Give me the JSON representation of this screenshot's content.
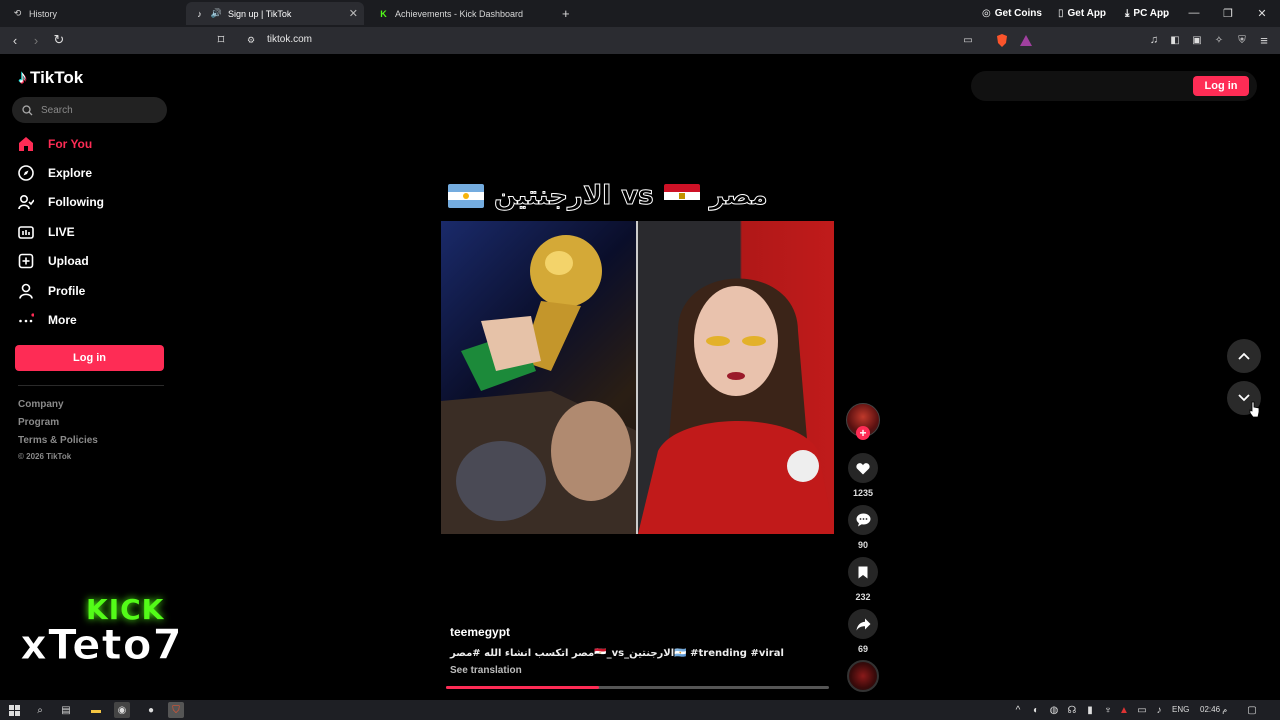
{
  "browser": {
    "tabs": [
      {
        "label": "History",
        "icon": "history-icon"
      },
      {
        "label": "Sign up | TikTok",
        "icon": "tiktok-icon"
      },
      {
        "label": "Achievements - Kick Dashboard",
        "icon": "kick-icon"
      }
    ],
    "url": "tiktok.com"
  },
  "sidebar": {
    "logo_text": "TikTok",
    "search_placeholder": "Search",
    "items": [
      {
        "label": "For You",
        "icon": "home-icon",
        "active": true
      },
      {
        "label": "Explore",
        "icon": "compass-icon"
      },
      {
        "label": "Following",
        "icon": "following-icon"
      },
      {
        "label": "LIVE",
        "icon": "live-icon"
      },
      {
        "label": "Upload",
        "icon": "upload-icon"
      },
      {
        "label": "Profile",
        "icon": "profile-icon"
      },
      {
        "label": "More",
        "icon": "more-icon"
      }
    ],
    "login_label": "Log in",
    "footer_links": [
      "Company",
      "Program",
      "Terms & Policies"
    ],
    "copyright": "© 2026 TikTok"
  },
  "top_actions": {
    "get_coins": "Get Coins",
    "get_app": "Get App",
    "pc_app": "PC App",
    "login": "Log in"
  },
  "video": {
    "title_left": "الارجنتين",
    "title_vs": "vs",
    "title_right": "مصر",
    "username": "teemegypt",
    "caption": "مصر اتكسب انشاء الله #مصر🇪🇬_vs_الارجنتين🇦🇷 #trending #viral",
    "see_translation": "See translation",
    "likes": "1235",
    "comments": "90",
    "saves": "232",
    "shares": "69",
    "progress": 0.4
  },
  "overlay": {
    "kick_label": "KICK",
    "streamer_name": "xTeto7"
  },
  "taskbar": {
    "language": "ENG",
    "time": "02:46 م"
  },
  "colors": {
    "accent": "#fe2c55",
    "kick_green": "#53fc18",
    "background": "#000000"
  }
}
